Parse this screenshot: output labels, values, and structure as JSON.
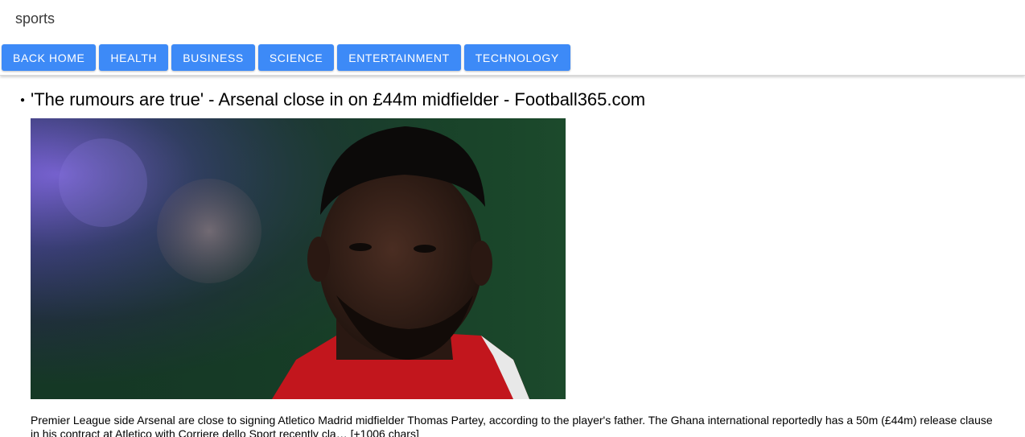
{
  "header": {
    "category": "sports"
  },
  "nav": {
    "buttons": [
      {
        "label": "BACK HOME"
      },
      {
        "label": "HEALTH"
      },
      {
        "label": "BUSINESS"
      },
      {
        "label": "SCIENCE"
      },
      {
        "label": "ENTERTAINMENT"
      },
      {
        "label": "TECHNOLOGY"
      }
    ],
    "button_color": "#3d8af7"
  },
  "articles": [
    {
      "title": "'The rumours are true' - Arsenal close in on £44m midfielder - Football365.com",
      "image_subject": "footballer-portrait",
      "description_line1": "Premier League side Arsenal are close to signing Atletico Madrid midfielder Thomas Partey, according to the player's father. The Ghana international reportedly has a 50m (£44m) release clause",
      "description_line2": "in his contract at Atletico with Corriere dello Sport recently cla… [+1006 chars]"
    }
  ]
}
